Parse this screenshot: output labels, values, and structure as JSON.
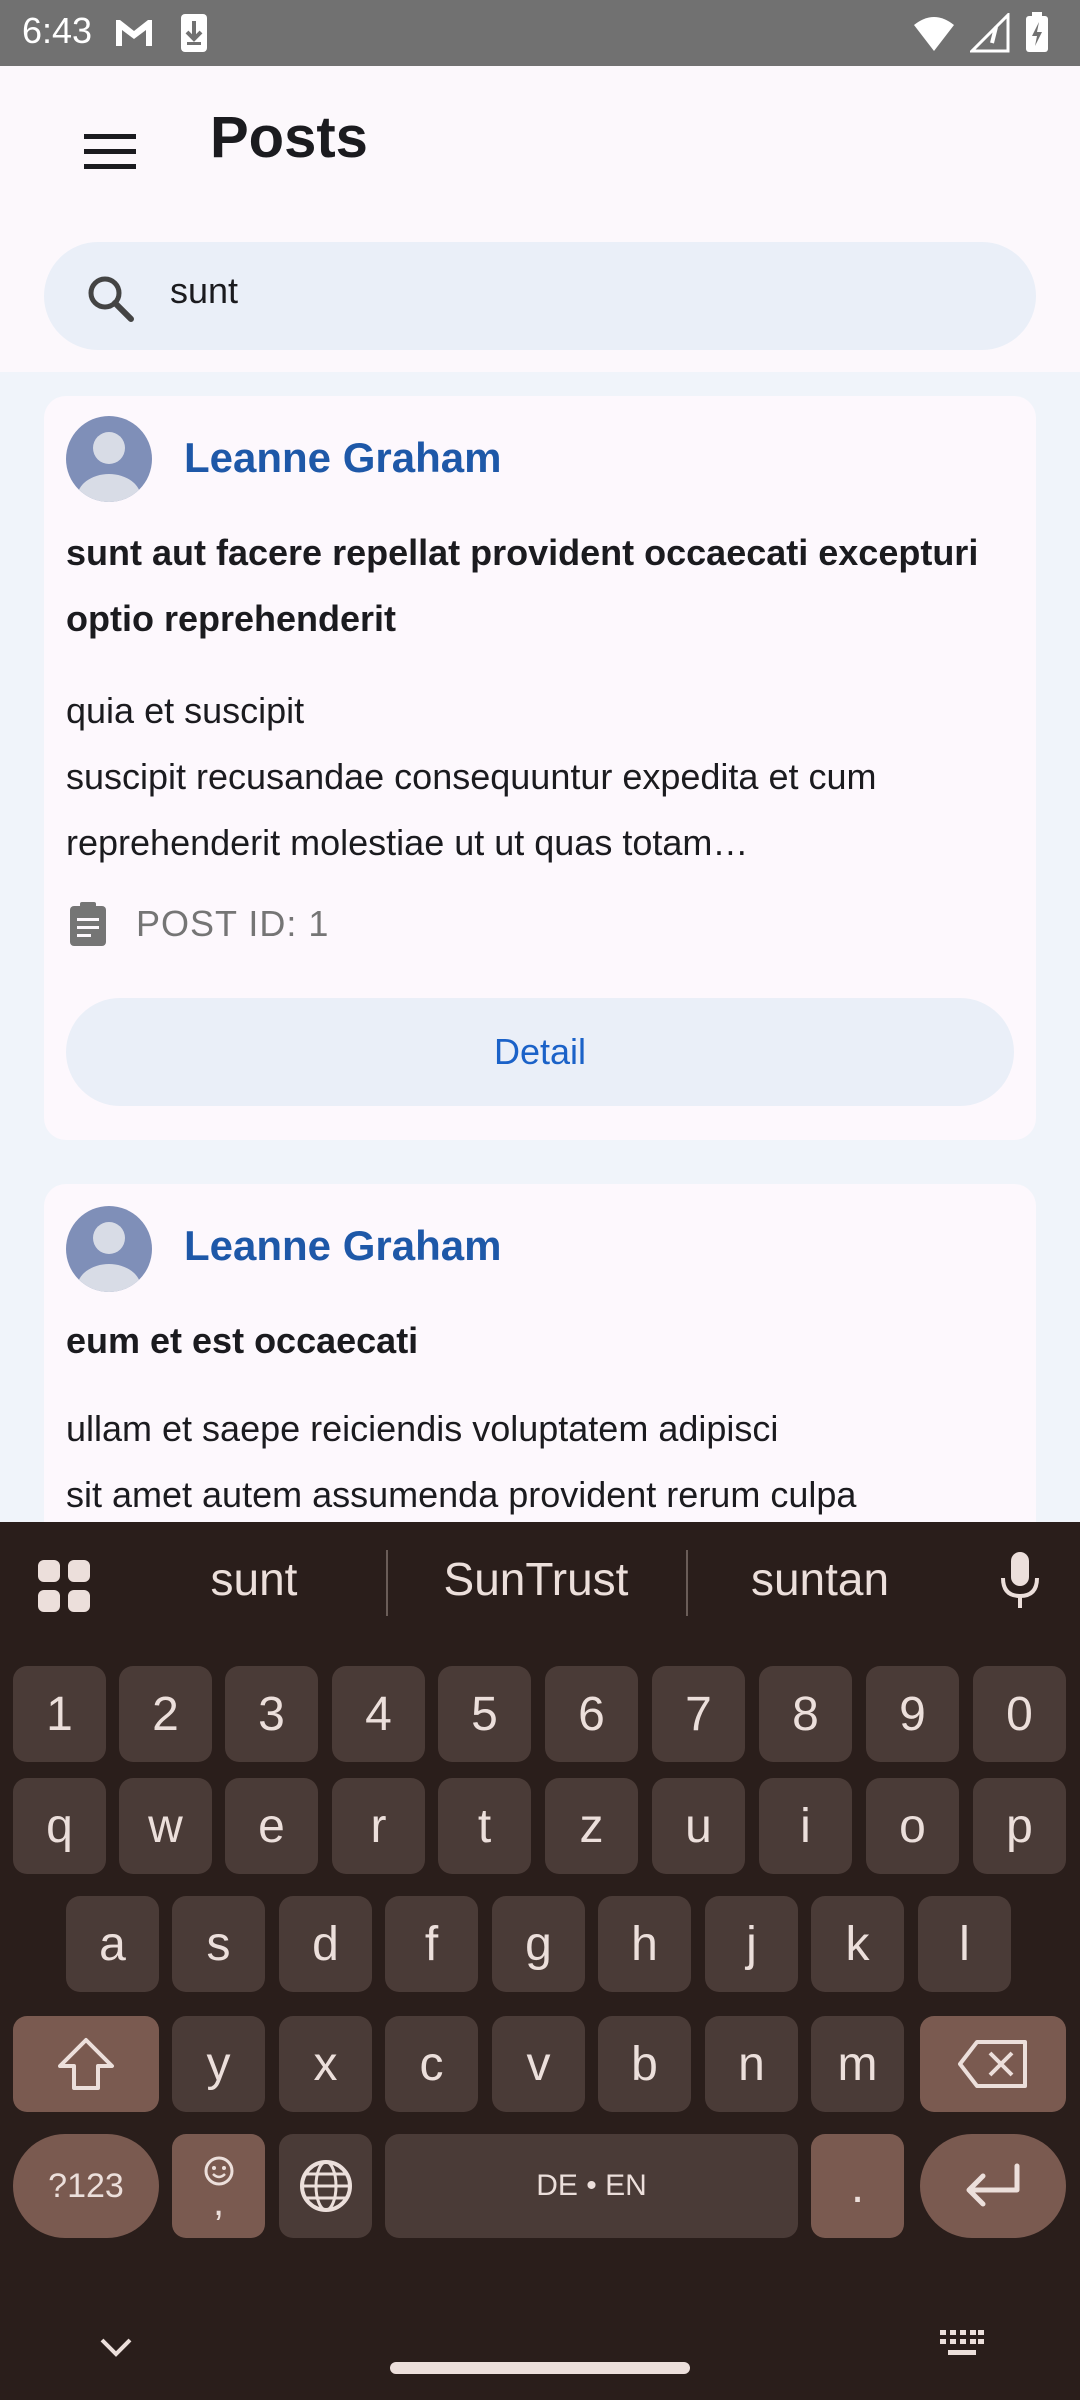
{
  "status_bar": {
    "time": "6:43"
  },
  "app_bar": {
    "title": "Posts"
  },
  "search": {
    "value": "sunt"
  },
  "posts": [
    {
      "author": "Leanne Graham",
      "title": "sunt aut facere repellat provident occaecati excepturi optio reprehenderit",
      "body": "quia et suscipit\nsuscipit recusandae consequuntur expedita et cum reprehenderit molestiae ut ut quas totam…",
      "post_id": "POST ID: 1",
      "detail_label": "Detail"
    },
    {
      "author": "Leanne Graham",
      "title": "eum et est occaecati",
      "body": "ullam et saepe reiciendis voluptatem adipisci\nsit amet autem assumenda provident rerum culpa"
    }
  ],
  "keyboard": {
    "suggestions": [
      "sunt",
      "SunTrust",
      "suntan"
    ],
    "row_numbers": [
      "1",
      "2",
      "3",
      "4",
      "5",
      "6",
      "7",
      "8",
      "9",
      "0"
    ],
    "row_1": [
      "q",
      "w",
      "e",
      "r",
      "t",
      "z",
      "u",
      "i",
      "o",
      "p"
    ],
    "row_2": [
      "a",
      "s",
      "d",
      "f",
      "g",
      "h",
      "j",
      "k",
      "l"
    ],
    "row_3": [
      "y",
      "x",
      "c",
      "v",
      "b",
      "n",
      "m"
    ],
    "symbols_label": "?123",
    "comma_label": ",",
    "space_label": "DE • EN",
    "period_label": ".",
    "icons": [
      "grid-icon",
      "mic-icon",
      "shift-icon",
      "backspace-icon",
      "emoji-icon",
      "globe-icon",
      "enter-icon",
      "keyboard-hide-icon",
      "keyboard-switch-icon"
    ]
  }
}
